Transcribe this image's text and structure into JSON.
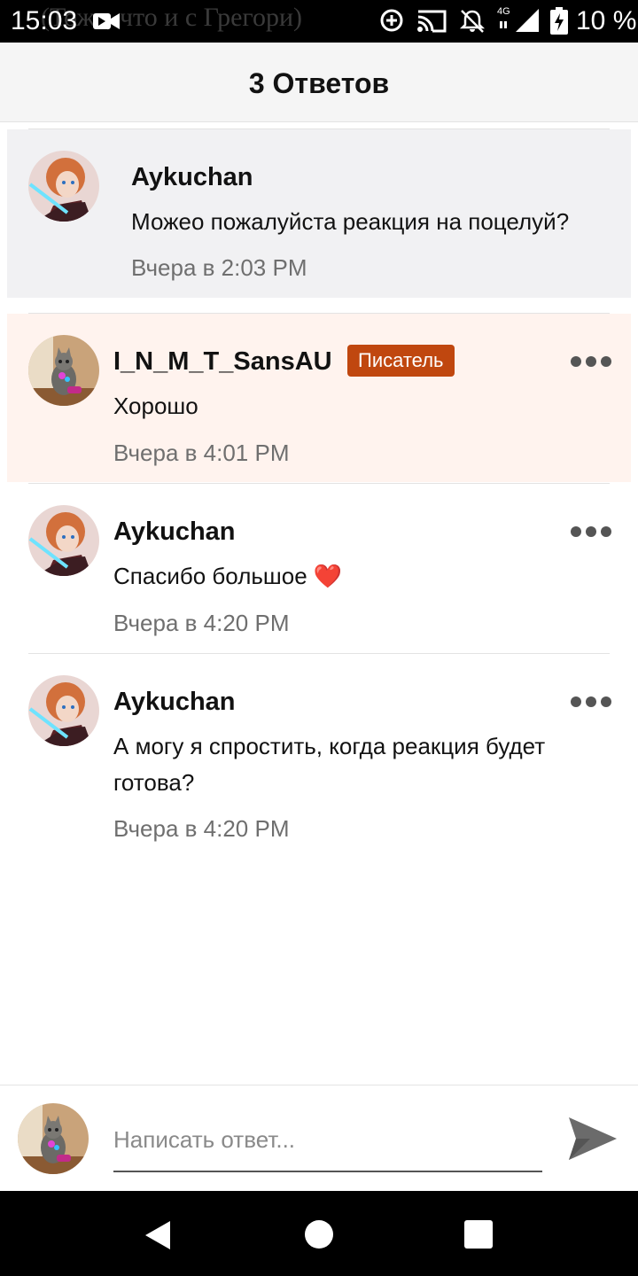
{
  "status_bar": {
    "time": "15:03",
    "ghost_text": "(Тоже, что и с Грегори)",
    "network_label": "4G",
    "battery_text": "10 %"
  },
  "header": {
    "title": "3 Ответов"
  },
  "comments": [
    {
      "username": "Aykuchan",
      "text": "Можео пожалуйста реакция на поцелуй?",
      "time": "Вчера в 2:03 PM",
      "avatar_icon": "avatar-anime-icon"
    },
    {
      "username": "I_N_M_T_SansAU",
      "badge": "Писатель",
      "text": "Хорошо",
      "time": "Вчера в 4:01 PM",
      "avatar_icon": "avatar-cat-icon"
    },
    {
      "username": "Aykuchan",
      "text": "Спасибо большое ❤️",
      "time": "Вчера в 4:20 PM",
      "avatar_icon": "avatar-anime-icon"
    },
    {
      "username": "Aykuchan",
      "text": "А могу я спростить, когда реакция будет готова?",
      "time": "Вчера в 4:20 PM",
      "avatar_icon": "avatar-anime-icon"
    }
  ],
  "reply": {
    "placeholder": "Написать ответ..."
  },
  "colors": {
    "badge": "#c0470f",
    "author_highlight": "#fff3ee",
    "parent_background": "#f1f1f3"
  }
}
